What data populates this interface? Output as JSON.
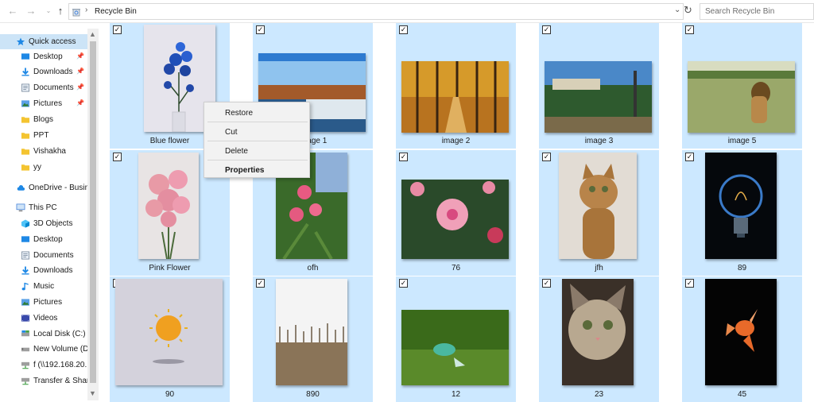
{
  "address": {
    "path": "Recycle Bin",
    "search_placeholder": "Search Recycle Bin"
  },
  "sidebar": {
    "quick_access": "Quick access",
    "quick_items": [
      "Desktop",
      "Downloads",
      "Documents",
      "Pictures",
      "Blogs",
      "PPT",
      "Vishakha",
      "yy"
    ],
    "onedrive": "OneDrive - Busin",
    "this_pc": "This PC",
    "pc_items": [
      "3D Objects",
      "Desktop",
      "Documents",
      "Downloads",
      "Music",
      "Pictures",
      "Videos",
      "Local Disk (C:)",
      "New Volume (D",
      "f (\\\\192.168.20.",
      "Transfer & Shar"
    ]
  },
  "files": [
    {
      "name": "Blue flower"
    },
    {
      "name": "image 1"
    },
    {
      "name": "image 2"
    },
    {
      "name": "image 3"
    },
    {
      "name": "image 5"
    },
    {
      "name": "Pink Flower"
    },
    {
      "name": "ofh"
    },
    {
      "name": "76"
    },
    {
      "name": "jfh"
    },
    {
      "name": "89"
    },
    {
      "name": "90"
    },
    {
      "name": "890"
    },
    {
      "name": "12"
    },
    {
      "name": "23"
    },
    {
      "name": "45"
    }
  ],
  "context_menu": {
    "restore": "Restore",
    "cut": "Cut",
    "delete": "Delete",
    "properties": "Properties"
  },
  "colors": {
    "selection": "#cce8ff",
    "sidebar_active": "#cce4f7"
  }
}
